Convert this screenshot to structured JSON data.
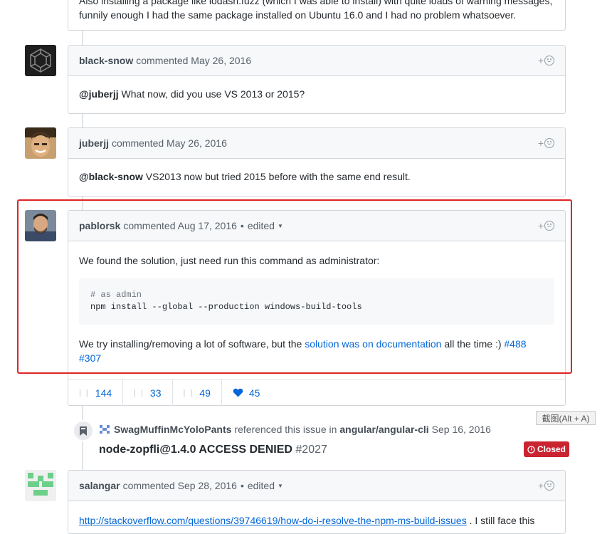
{
  "top_comment": {
    "line1": "Also installing a package like lodash.fuzz (which I was able to install) with quite loads of warning messages,",
    "line2": "funnily enough I had the same package installed on Ubuntu 16.0 and I had no problem whatsoever."
  },
  "comments": [
    {
      "author": "black-snow",
      "meta": "commented May 26, 2016",
      "mention": "@juberjj",
      "text": " What now, did you use VS 2013 or 2015?"
    },
    {
      "author": "juberjj",
      "meta": "commented May 26, 2016",
      "mention": "@black-snow",
      "text": " VS2013 now but tried 2015 before with the same end result."
    },
    {
      "author": "pablorsk",
      "meta": "commented Aug 17, 2016",
      "edited": "edited",
      "p1": "We found the solution, just need run this command as administrator:",
      "code_line1": "# as admin",
      "code_line2": "npm install --global --production windows-build-tools",
      "p2_prefix": "We try installing/removing a lot of software, but the ",
      "p2_link": "solution was on documentation",
      "p2_mid": " all the time :) ",
      "issue1": "#488",
      "issue2": "#307"
    },
    {
      "author": "salangar",
      "meta": "commented Sep 28, 2016",
      "edited": "edited",
      "link_text": "http://stackoverflow.com/questions/39746619/how-do-i-resolve-the-npm-ms-build-issues",
      "trailing": " . I still face this"
    }
  ],
  "reaction_button": {
    "plus": "+"
  },
  "reactions": [
    {
      "icon": "thumbs-up-icon",
      "count": "144"
    },
    {
      "icon": "laugh-icon",
      "count": "33"
    },
    {
      "icon": "hooray-icon",
      "count": "49"
    },
    {
      "icon": "heart-icon",
      "count": "45"
    }
  ],
  "reference": {
    "user": "SwagMuffinMcYoloPants",
    "text": "referenced this issue in",
    "repo": "angular/angular-cli",
    "date": "Sep 16, 2016",
    "title": "node-zopfli@1.4.0 ACCESS DENIED",
    "number": "#2027",
    "state": "Closed"
  },
  "tooltip": "截图(Alt + A)",
  "colors": {
    "link": "#0366d6",
    "highlight": "#e02323",
    "closed": "#cb2431",
    "heart": "#0366d6"
  }
}
